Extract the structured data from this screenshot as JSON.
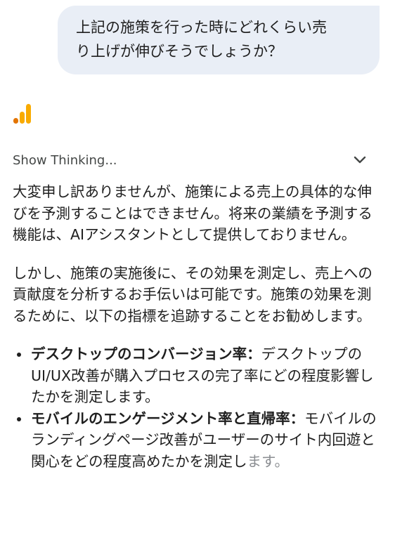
{
  "user_message": {
    "line1": "上記の施策を行った時にどれくらい売",
    "line2": "り上げが伸びそうでしょうか？"
  },
  "thinking": {
    "label": "Show Thinking...",
    "toggle_icon": "chevron-down-icon"
  },
  "answer": {
    "para1": "大変申し訳ありませんが、施策による売上の具体的な伸びを予測することはできません。将来の業績を予測する機能は、AIアシスタントとして提供しておりません。",
    "para2": "しかし、施策の実施後に、その効果を測定し、売上への貢献度を分析するお手伝いは可能です。施策の効果を測るために、以下の指標を追跡することをお勧めします。",
    "bullets": [
      {
        "title": "デスクトップのコンバージョン率：",
        "text": "デスクトップのUI/UX改善が購入プロセスの完了率にどの程度影響したかを測定します。"
      },
      {
        "title": "モバイルのエンゲージメント率と直帰率：",
        "text": "モバイルのランディングページ改善がユーザーのサイト内回遊と関心をどの程度高めたかを測定し",
        "text_tail": "ます。"
      }
    ]
  },
  "colors": {
    "bubble": "#e9eef6",
    "icon_orange": "#f9ab00",
    "icon_dark_orange": "#e37400",
    "text": "#1f1f1f"
  }
}
